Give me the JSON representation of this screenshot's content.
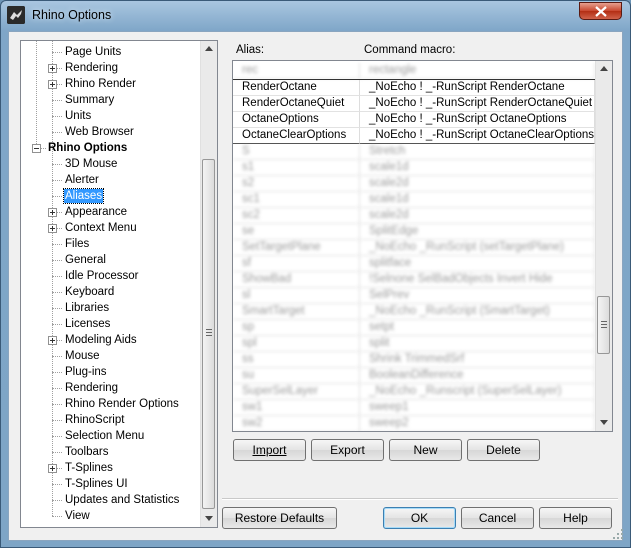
{
  "window": {
    "title": "Rhino Options"
  },
  "tree": {
    "items": [
      {
        "label": "Page Units",
        "indent": 2,
        "expander": null,
        "selected": false,
        "bold": false
      },
      {
        "label": "Rendering",
        "indent": 2,
        "expander": "plus",
        "selected": false,
        "bold": false
      },
      {
        "label": "Rhino Render",
        "indent": 2,
        "expander": "plus",
        "selected": false,
        "bold": false
      },
      {
        "label": "Summary",
        "indent": 2,
        "expander": null,
        "selected": false,
        "bold": false
      },
      {
        "label": "Units",
        "indent": 2,
        "expander": null,
        "selected": false,
        "bold": false
      },
      {
        "label": "Web Browser",
        "indent": 2,
        "expander": null,
        "selected": false,
        "bold": false
      },
      {
        "label": "Rhino Options",
        "indent": 1,
        "expander": "minus",
        "selected": false,
        "bold": true
      },
      {
        "label": "3D Mouse",
        "indent": 2,
        "expander": null,
        "selected": false,
        "bold": false
      },
      {
        "label": "Alerter",
        "indent": 2,
        "expander": null,
        "selected": false,
        "bold": false
      },
      {
        "label": "Aliases",
        "indent": 2,
        "expander": null,
        "selected": true,
        "bold": false
      },
      {
        "label": "Appearance",
        "indent": 2,
        "expander": "plus",
        "selected": false,
        "bold": false
      },
      {
        "label": "Context Menu",
        "indent": 2,
        "expander": "plus",
        "selected": false,
        "bold": false
      },
      {
        "label": "Files",
        "indent": 2,
        "expander": null,
        "selected": false,
        "bold": false
      },
      {
        "label": "General",
        "indent": 2,
        "expander": null,
        "selected": false,
        "bold": false
      },
      {
        "label": "Idle Processor",
        "indent": 2,
        "expander": null,
        "selected": false,
        "bold": false
      },
      {
        "label": "Keyboard",
        "indent": 2,
        "expander": null,
        "selected": false,
        "bold": false
      },
      {
        "label": "Libraries",
        "indent": 2,
        "expander": null,
        "selected": false,
        "bold": false
      },
      {
        "label": "Licenses",
        "indent": 2,
        "expander": null,
        "selected": false,
        "bold": false
      },
      {
        "label": "Modeling Aids",
        "indent": 2,
        "expander": "plus",
        "selected": false,
        "bold": false
      },
      {
        "label": "Mouse",
        "indent": 2,
        "expander": null,
        "selected": false,
        "bold": false
      },
      {
        "label": "Plug-ins",
        "indent": 2,
        "expander": null,
        "selected": false,
        "bold": false
      },
      {
        "label": "Rendering",
        "indent": 2,
        "expander": null,
        "selected": false,
        "bold": false
      },
      {
        "label": "Rhino Render Options",
        "indent": 2,
        "expander": null,
        "selected": false,
        "bold": false
      },
      {
        "label": "RhinoScript",
        "indent": 2,
        "expander": null,
        "selected": false,
        "bold": false
      },
      {
        "label": "Selection Menu",
        "indent": 2,
        "expander": null,
        "selected": false,
        "bold": false
      },
      {
        "label": "Toolbars",
        "indent": 2,
        "expander": null,
        "selected": false,
        "bold": false
      },
      {
        "label": "T-Splines",
        "indent": 2,
        "expander": "plus",
        "selected": false,
        "bold": false
      },
      {
        "label": "T-Splines UI",
        "indent": 2,
        "expander": null,
        "selected": false,
        "bold": false
      },
      {
        "label": "Updates and Statistics",
        "indent": 2,
        "expander": null,
        "selected": false,
        "bold": false
      },
      {
        "label": "View",
        "indent": 2,
        "expander": null,
        "selected": false,
        "bold": false
      }
    ]
  },
  "aliases": {
    "alias_header": "Alias:",
    "macro_header": "Command macro:",
    "rows": [
      {
        "alias": "rec",
        "macro": "rectangle",
        "blurred": true
      },
      {
        "alias": "RenderOctane",
        "macro": "_NoEcho ! _-RunScript RenderOctane",
        "blurred": false
      },
      {
        "alias": "RenderOctaneQuiet",
        "macro": "_NoEcho ! _-RunScript RenderOctaneQuiet",
        "blurred": false
      },
      {
        "alias": "OctaneOptions",
        "macro": "_NoEcho ! _-RunScript OctaneOptions",
        "blurred": false
      },
      {
        "alias": "OctaneClearOptions",
        "macro": "_NoEcho ! _-RunScript OctaneClearOptions",
        "blurred": false
      },
      {
        "alias": "S",
        "macro": "Stretch",
        "blurred": true
      },
      {
        "alias": "s1",
        "macro": "scale1d",
        "blurred": true
      },
      {
        "alias": "s2",
        "macro": "scale2d",
        "blurred": true
      },
      {
        "alias": "sc1",
        "macro": "scale1d",
        "blurred": true
      },
      {
        "alias": "sc2",
        "macro": "scale2d",
        "blurred": true
      },
      {
        "alias": "se",
        "macro": "SplitEdge",
        "blurred": true
      },
      {
        "alias": "SetTargetPlane",
        "macro": "_NoEcho _RunScript (setTargetPlane)",
        "blurred": true
      },
      {
        "alias": "sf",
        "macro": "splitface",
        "blurred": true
      },
      {
        "alias": "ShowBad",
        "macro": "!Selnone SelBadObjects Invert Hide",
        "blurred": true
      },
      {
        "alias": "sl",
        "macro": "SelPrev",
        "blurred": true
      },
      {
        "alias": "SmartTarget",
        "macro": "_NoEcho _RunScript (SmartTarget)",
        "blurred": true
      },
      {
        "alias": "sp",
        "macro": "setpt",
        "blurred": true
      },
      {
        "alias": "spl",
        "macro": "split",
        "blurred": true
      },
      {
        "alias": "ss",
        "macro": "Shrink TrimmedSrf",
        "blurred": true
      },
      {
        "alias": "su",
        "macro": "BooleanDifference",
        "blurred": true
      },
      {
        "alias": "SuperSelLayer",
        "macro": "_NoEcho _Runscript (SuperSelLayer)",
        "blurred": true
      },
      {
        "alias": "sw1",
        "macro": "sweep1",
        "blurred": true
      },
      {
        "alias": "sw2",
        "macro": "sweep2",
        "blurred": true
      }
    ]
  },
  "buttons": {
    "import": "Import",
    "export": "Export",
    "new": "New",
    "delete": "Delete",
    "restore_defaults": "Restore Defaults",
    "ok": "OK",
    "cancel": "Cancel",
    "help": "Help"
  }
}
